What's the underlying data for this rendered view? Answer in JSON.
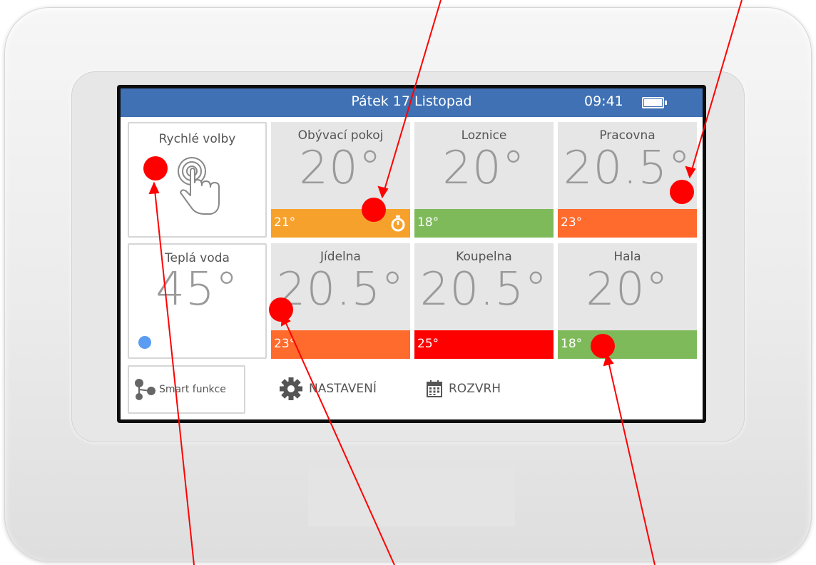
{
  "topbar": {
    "date": "Pátek 17 Listopad",
    "time": "09:41",
    "battery_icon": "battery-full-icon"
  },
  "quick": {
    "label": "Rychlé volby",
    "icon": "hand-tap-icon"
  },
  "water": {
    "label": "Teplá voda",
    "temp": "45°",
    "status_color": "#5a9cf2"
  },
  "rooms": [
    {
      "name": "Obývací pokoj",
      "temp": "20°",
      "target": "21°",
      "bar_color": "#f7a12d",
      "timer_icon": "stopwatch-icon"
    },
    {
      "name": "Loznice",
      "temp": "20°",
      "target": "18°",
      "bar_color": "#7fba5a"
    },
    {
      "name": "Pracovna",
      "temp": "20.5°",
      "target": "23°",
      "bar_color": "#ff6a2d"
    },
    {
      "name": "Jídelna",
      "temp": "20.5°",
      "target": "23°",
      "bar_color": "#ff6a2d"
    },
    {
      "name": "Koupelna",
      "temp": "20.5°",
      "target": "25°",
      "bar_color": "#ff0000"
    },
    {
      "name": "Hala",
      "temp": "20°",
      "target": "18°",
      "bar_color": "#7fba5a"
    }
  ],
  "bottom": {
    "smart": "Smart funkce",
    "settings": "NASTAVENÍ",
    "schedule": "ROZVRH"
  },
  "colors": {
    "topbar": "#3f71b4",
    "annotation": "#ff0000"
  }
}
